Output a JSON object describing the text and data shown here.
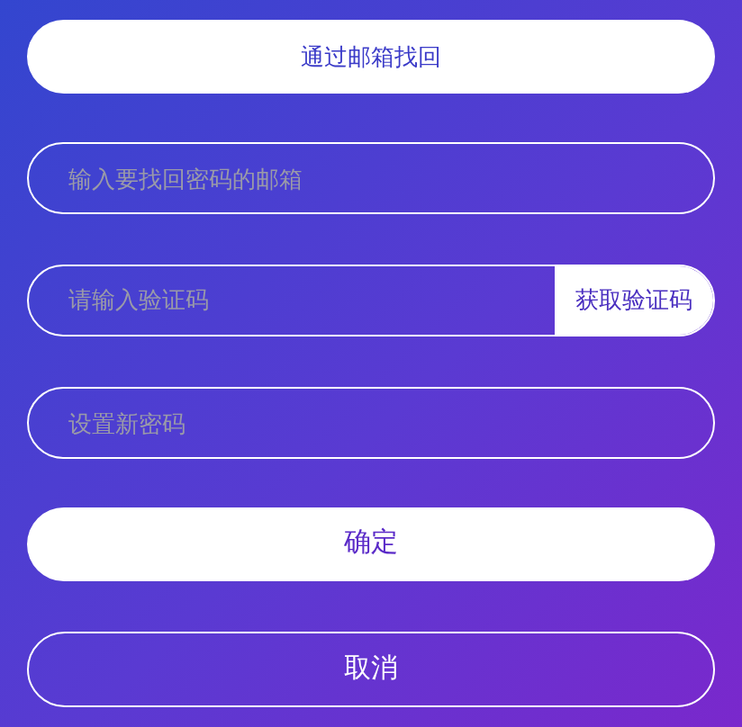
{
  "mode_button": "通过邮箱找回",
  "fields": [
    {
      "kind": "plain",
      "placeholder": "输入要找回密码的邮箱"
    },
    {
      "kind": "code",
      "placeholder": "请输入验证码",
      "action": "获取验证码"
    },
    {
      "kind": "plain",
      "placeholder": "设置新密码"
    }
  ],
  "buttons": [
    {
      "kind": "primary",
      "label": "确定"
    },
    {
      "kind": "outline",
      "label": "取消"
    }
  ]
}
